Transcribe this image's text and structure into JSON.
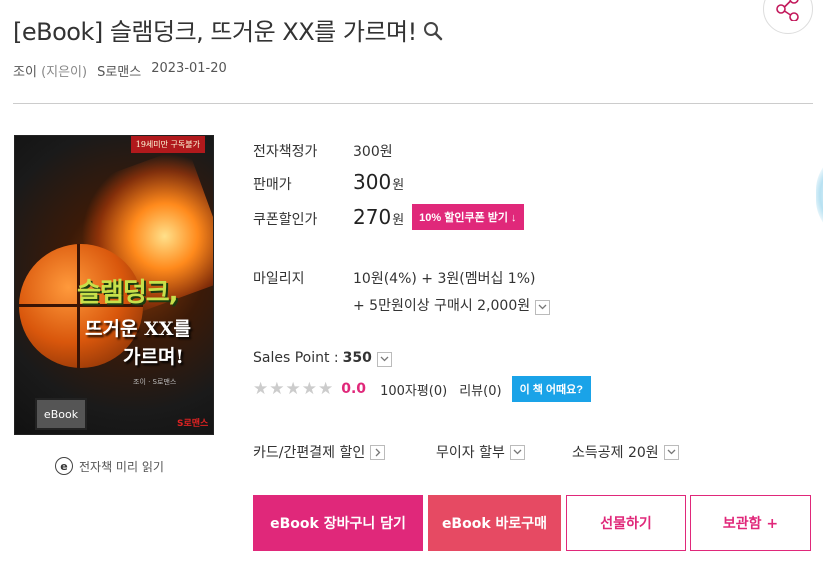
{
  "product": {
    "title": "[eBook] 슬램덩크, 뜨거운 XX를 가르며!",
    "author": "조이",
    "author_role": "(지은이)",
    "publisher": "S로맨스",
    "date": "2023-01-20"
  },
  "cover": {
    "adult_label": "19세미만 구독불가",
    "title_line1": "슬램덩크,",
    "title_line2": "뜨거운 XX를",
    "title_line3": "가르며!",
    "author_line": "조이 · S로맨스",
    "badge": "eBook",
    "publisher_logo_s": "S",
    "publisher_logo_rest": "로맨스"
  },
  "preview": {
    "icon": "e",
    "label": "전자책 미리 읽기"
  },
  "pricing": {
    "list_price_label": "전자책정가",
    "list_price": "300원",
    "sale_price_label": "판매가",
    "sale_price": "300",
    "won": "원",
    "coupon_price_label": "쿠폰할인가",
    "coupon_price": "270",
    "coupon_button": "10% 할인쿠폰 받기 ↓"
  },
  "mileage": {
    "label": "마일리지",
    "line1": "10원(4%) + 3원(멤버십 1%)",
    "line2": "+ 5만원이상 구매시 2,000원"
  },
  "sales": {
    "label": "Sales Point :",
    "value": "350"
  },
  "rating": {
    "stars_filled": 0,
    "stars_total": 5,
    "score": "0.0",
    "reviews_100": "100자평(0)",
    "reviews": "리뷰(0)",
    "how_button": "이 책 어때요?"
  },
  "options": {
    "card": "카드/간편결제 할인",
    "installment": "무이자 할부",
    "deduction": "소득공제 20원"
  },
  "actions": {
    "cart": "eBook 장바구니 담기",
    "buy_now": "eBook 바로구매",
    "gift": "선물하기",
    "save": "보관함 +"
  },
  "colors": {
    "accent_pink": "#e0287a",
    "buy_red": "#e64a63",
    "blue_button": "#1aa3e8"
  },
  "icons": {
    "search": "search-icon",
    "share": "share-icon",
    "chevron": "chevron-down-icon",
    "arrow": "chevron-right-icon",
    "star": "star-icon"
  }
}
